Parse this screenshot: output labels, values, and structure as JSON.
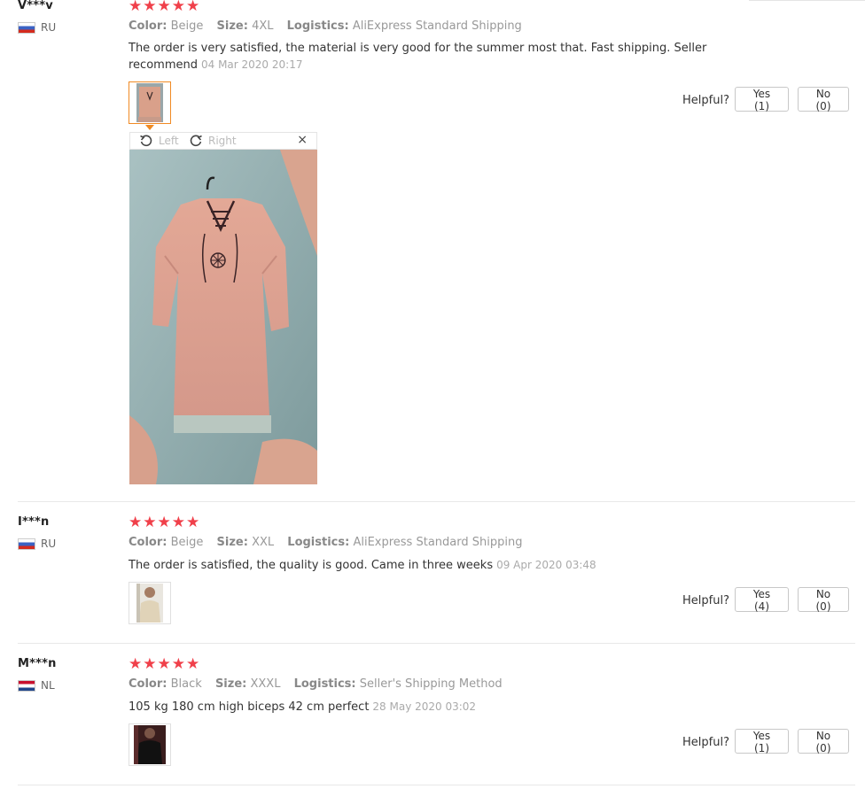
{
  "reviews": [
    {
      "user": "V***v",
      "country": "RU",
      "stars": "★★★★★",
      "color_label": "Color:",
      "color": "Beige",
      "size_label": "Size:",
      "size": "4XL",
      "logistics_label": "Logistics:",
      "logistics": "AliExpress Standard Shipping",
      "text": "The order is very satisfied, the material is very good for the summer most that. Fast shipping. Seller recommend",
      "date": "04 Mar 2020 20:17",
      "helpful_label": "Helpful?",
      "yes_label": "Yes (1)",
      "no_label": "No (0)"
    },
    {
      "user": "I***n",
      "country": "RU",
      "stars": "★★★★★",
      "color_label": "Color:",
      "color": "Beige",
      "size_label": "Size:",
      "size": "XXL",
      "logistics_label": "Logistics:",
      "logistics": "AliExpress Standard Shipping",
      "text": "The order is satisfied, the quality is good. Came in three weeks",
      "date": "09 Apr 2020 03:48",
      "helpful_label": "Helpful?",
      "yes_label": "Yes (4)",
      "no_label": "No (0)"
    },
    {
      "user": "M***n",
      "country": "NL",
      "stars": "★★★★★",
      "color_label": "Color:",
      "color": "Black",
      "size_label": "Size:",
      "size": "XXXL",
      "logistics_label": "Logistics:",
      "logistics": "Seller's Shipping Method",
      "text": "105 kg 180 cm high biceps 42 cm perfect",
      "date": "28 May 2020 03:02",
      "helpful_label": "Helpful?",
      "yes_label": "Yes (1)",
      "no_label": "No (0)"
    }
  ],
  "viewer": {
    "left_label": "Left",
    "right_label": "Right",
    "close_label": "×",
    "rotate_left_icon": "rotate-left-icon",
    "rotate_right_icon": "rotate-right-icon"
  },
  "colors": {
    "star": "#f0404a",
    "active_thumb_border": "#f08a24",
    "date": "#aaaaaa"
  }
}
